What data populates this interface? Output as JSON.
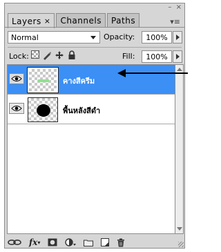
{
  "window": {
    "collapse_glyph": "–",
    "close_glyph": "×",
    "menu_glyph": "▾≡"
  },
  "tabs": [
    {
      "label": "Layers",
      "close": "×",
      "active": true
    },
    {
      "label": "Channels",
      "active": false
    },
    {
      "label": "Paths",
      "active": false
    }
  ],
  "blend": {
    "value": "Normal"
  },
  "opacity": {
    "label": "Opacity:",
    "value": "100%"
  },
  "lock": {
    "label": "Lock:",
    "icons": [
      "lock-transparency-icon",
      "lock-image-pixels-icon",
      "lock-position-icon",
      "lock-all-icon"
    ]
  },
  "fill": {
    "label": "Fill:",
    "value": "100%"
  },
  "layers": [
    {
      "name": "คางสีครีม",
      "selected": true,
      "thumb": "cream-bar"
    },
    {
      "name": "พื้นหลังสีดำ",
      "selected": false,
      "thumb": "black-blob"
    }
  ],
  "toolbar": {
    "icons": [
      "link-layers-icon",
      "layer-style-icon",
      "add-mask-icon",
      "adjustment-layer-icon",
      "new-group-icon",
      "new-layer-icon",
      "trash-icon"
    ],
    "fx_label": "fx"
  },
  "colors": {
    "selection": "#3b8ff5",
    "panel": "#d6d6d6"
  }
}
